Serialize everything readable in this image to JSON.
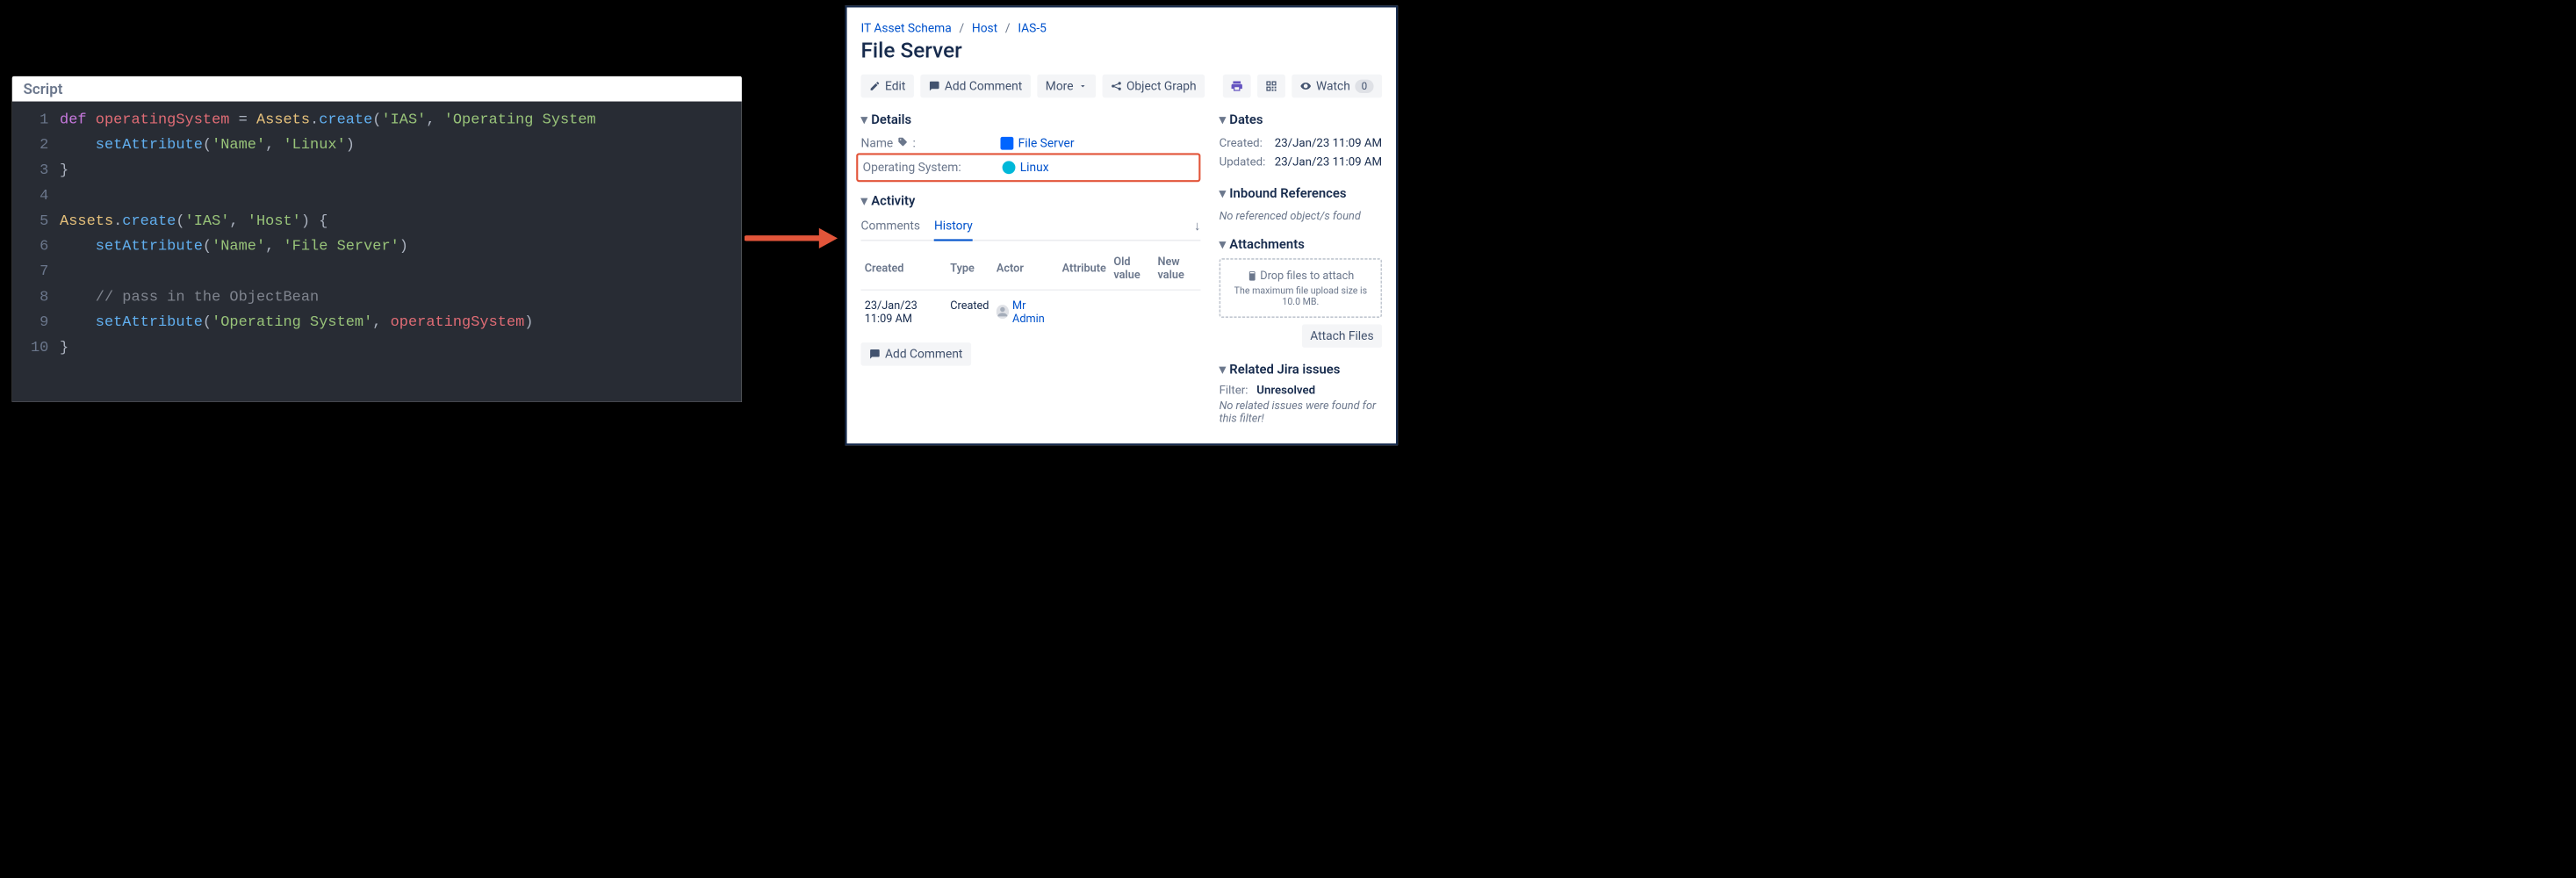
{
  "editor": {
    "label": "Script",
    "lines": [
      [
        {
          "t": "kw",
          "v": "def"
        },
        {
          "t": "sp"
        },
        {
          "t": "ident",
          "v": "operatingSystem"
        },
        {
          "t": "sp"
        },
        {
          "t": "punc",
          "v": "="
        },
        {
          "t": "sp"
        },
        {
          "t": "cls",
          "v": "Assets"
        },
        {
          "t": "punc",
          "v": "."
        },
        {
          "t": "fn",
          "v": "create"
        },
        {
          "t": "punc",
          "v": "("
        },
        {
          "t": "str",
          "v": "'IAS'"
        },
        {
          "t": "punc",
          "v": ", "
        },
        {
          "t": "str",
          "v": "'Operating System"
        }
      ],
      [
        {
          "t": "indent",
          "n": 1
        },
        {
          "t": "fn",
          "v": "setAttribute"
        },
        {
          "t": "punc",
          "v": "("
        },
        {
          "t": "str",
          "v": "'Name'"
        },
        {
          "t": "punc",
          "v": ", "
        },
        {
          "t": "str",
          "v": "'Linux'"
        },
        {
          "t": "punc",
          "v": ")"
        }
      ],
      [
        {
          "t": "punc",
          "v": "}"
        }
      ],
      [],
      [
        {
          "t": "cls",
          "v": "Assets"
        },
        {
          "t": "punc",
          "v": "."
        },
        {
          "t": "fn",
          "v": "create"
        },
        {
          "t": "punc",
          "v": "("
        },
        {
          "t": "str",
          "v": "'IAS'"
        },
        {
          "t": "punc",
          "v": ", "
        },
        {
          "t": "str",
          "v": "'Host'"
        },
        {
          "t": "punc",
          "v": ")"
        },
        {
          "t": "sp"
        },
        {
          "t": "punc",
          "v": "{"
        }
      ],
      [
        {
          "t": "indent",
          "n": 1
        },
        {
          "t": "fn",
          "v": "setAttribute"
        },
        {
          "t": "punc",
          "v": "("
        },
        {
          "t": "str",
          "v": "'Name'"
        },
        {
          "t": "punc",
          "v": ", "
        },
        {
          "t": "str",
          "v": "'File Server'"
        },
        {
          "t": "punc",
          "v": ")"
        }
      ],
      [],
      [
        {
          "t": "indent",
          "n": 1
        },
        {
          "t": "cmt",
          "v": "// pass in the ObjectBean"
        }
      ],
      [
        {
          "t": "indent",
          "n": 1
        },
        {
          "t": "fn",
          "v": "setAttribute"
        },
        {
          "t": "punc",
          "v": "("
        },
        {
          "t": "str",
          "v": "'Operating System'"
        },
        {
          "t": "punc",
          "v": ", "
        },
        {
          "t": "ident",
          "v": "operatingSystem"
        },
        {
          "t": "punc",
          "v": ")"
        }
      ],
      [
        {
          "t": "punc",
          "v": "}"
        }
      ]
    ]
  },
  "panel": {
    "breadcrumb": [
      "IT Asset Schema",
      "Host",
      "IAS-5"
    ],
    "title": "File Server",
    "toolbar": {
      "edit": "Edit",
      "add_comment": "Add Comment",
      "more": "More",
      "object_graph": "Object Graph",
      "watch": "Watch",
      "watch_count": "0"
    },
    "details": {
      "heading": "Details",
      "rows": [
        {
          "label": "Name",
          "tag_icon": true,
          "value": "File Server",
          "link": true,
          "highlight": false,
          "icon_color": "#0065ff"
        },
        {
          "label": "Operating System:",
          "value": "Linux",
          "link": true,
          "highlight": true,
          "icon_color": "#00b8d9"
        }
      ]
    },
    "activity": {
      "heading": "Activity",
      "tabs": [
        "Comments",
        "History"
      ],
      "active_tab": "History",
      "columns": [
        "Created",
        "Type",
        "Actor",
        "Attribute",
        "Old value",
        "New value"
      ],
      "rows": [
        {
          "created": "23/Jan/23 11:09 AM",
          "type": "Created",
          "actor": "Mr Admin"
        }
      ],
      "add_comment": "Add Comment"
    },
    "dates": {
      "heading": "Dates",
      "rows": [
        {
          "k": "Created:",
          "v": "23/Jan/23 11:09 AM"
        },
        {
          "k": "Updated:",
          "v": "23/Jan/23 11:09 AM"
        }
      ]
    },
    "inbound": {
      "heading": "Inbound References",
      "empty": "No referenced object/s found"
    },
    "attachments": {
      "heading": "Attachments",
      "drop_main": "Drop files to attach",
      "drop_sub": "The maximum file upload size is 10.0 MB.",
      "button": "Attach Files"
    },
    "related": {
      "heading": "Related Jira issues",
      "filter_k": "Filter:",
      "filter_v": "Unresolved",
      "empty": "No related issues were found for this filter!"
    }
  }
}
